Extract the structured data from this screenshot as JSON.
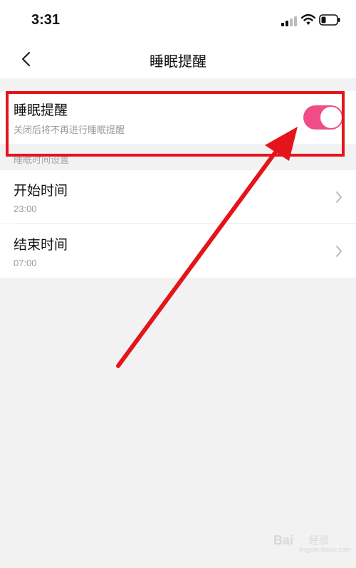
{
  "status_bar": {
    "time": "3:31"
  },
  "nav": {
    "title": "睡眠提醒"
  },
  "sleep_reminder": {
    "title": "睡眠提醒",
    "subtitle": "关闭后将不再进行睡眠提醒",
    "enabled": true,
    "toggle_color": "#f04d86"
  },
  "section": {
    "label": "睡眠时间设置"
  },
  "start_time": {
    "label": "开始时间",
    "value": "23:00"
  },
  "end_time": {
    "label": "结束时间",
    "value": "07:00"
  },
  "annotation": {
    "color": "#e5141b"
  },
  "watermark": {
    "brand": "Bai",
    "product": "经验",
    "url": "jingyan.baidu.com"
  }
}
